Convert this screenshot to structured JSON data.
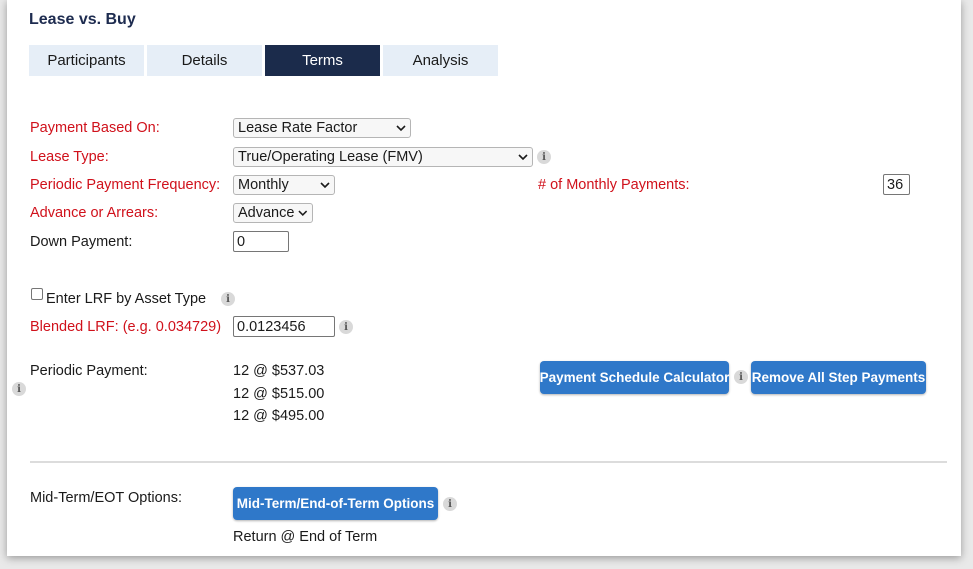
{
  "title": "Lease vs. Buy",
  "tabs": [
    {
      "label": "Participants"
    },
    {
      "label": "Details"
    },
    {
      "label": "Terms"
    },
    {
      "label": "Analysis"
    }
  ],
  "active_tab": "Terms",
  "form": {
    "payment_based_on": {
      "label": "Payment Based On:",
      "value": "Lease Rate Factor"
    },
    "lease_type": {
      "label": "Lease Type:",
      "value": "True/Operating Lease (FMV)"
    },
    "frequency": {
      "label": "Periodic Payment Frequency:",
      "value": "Monthly"
    },
    "num_payments": {
      "label": "# of Monthly Payments:",
      "value": "36"
    },
    "advance_arrears": {
      "label": "Advance or Arrears:",
      "value": "Advance"
    },
    "down_payment": {
      "label": "Down Payment:",
      "value": "0"
    },
    "enter_lrf": {
      "label": "Enter LRF by Asset Type",
      "checked": false
    },
    "blended_lrf": {
      "label": "Blended LRF: (e.g. 0.034729)",
      "value": "0.0123456"
    },
    "periodic_payment": {
      "label": "Periodic Payment:",
      "lines": [
        "12 @ $537.03",
        "12 @ $515.00",
        "12 @ $495.00"
      ]
    },
    "mid_term": {
      "label": "Mid-Term/EOT Options:",
      "value": "Return @ End of Term"
    }
  },
  "buttons": {
    "payment_schedule": "Payment Schedule Calculator",
    "remove_steps": "Remove All Step Payments",
    "mid_term_options": "Mid-Term/End-of-Term Options"
  },
  "colors": {
    "required_label": "#d0111b",
    "active_tab": "#1b2b4b",
    "button": "#2f78c9",
    "title": "#1d2b4f"
  },
  "icons": {
    "info": "i"
  }
}
